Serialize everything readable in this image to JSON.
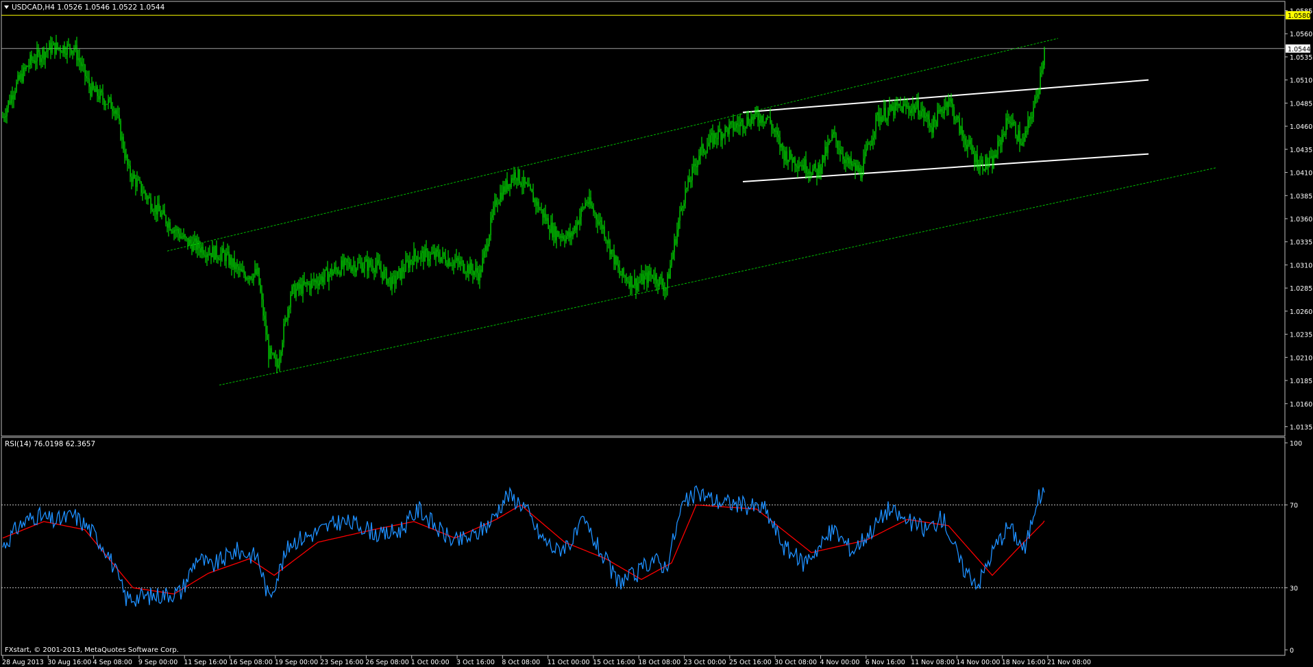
{
  "symbol_header": "USDCAD,H4  1.0526 1.0546 1.0522 1.0544",
  "indicator_header": "RSI(14) 76.0198 62.3657",
  "copyright": "FXstart, © 2001-2013, MetaQuotes Software Corp.",
  "colors": {
    "background": "#000000",
    "candle": "#00ff00",
    "grid_frame": "#c0c0c0",
    "resistance_line": "#ffff00",
    "channel_lines": "#00c000",
    "range_lines": "#ffffff",
    "rsi_line": "#1e90ff",
    "rsi_signal": "#ff0000"
  },
  "price_axis": {
    "ticks": [
      "1.0585",
      "1.0560",
      "1.0535",
      "1.0510",
      "1.0485",
      "1.0460",
      "1.0435",
      "1.0410",
      "1.0385",
      "1.0360",
      "1.0335",
      "1.0310",
      "1.0285",
      "1.0260",
      "1.0235",
      "1.0210",
      "1.0185",
      "1.0160",
      "1.0135"
    ],
    "current_price_label": "1.0544",
    "resistance_label": "1.0580"
  },
  "rsi_axis": {
    "ticks": [
      "100",
      "70",
      "30",
      "0"
    ]
  },
  "time_axis": {
    "labels": [
      "28 Aug 2013",
      "30 Aug 16:00",
      "4 Sep 08:00",
      "9 Sep 00:00",
      "11 Sep 16:00",
      "16 Sep 08:00",
      "19 Sep 00:00",
      "23 Sep 16:00",
      "26 Sep 08:00",
      "1 Oct 00:00",
      "3 Oct 16:00",
      "8 Oct 08:00",
      "11 Oct 00:00",
      "15 Oct 16:00",
      "18 Oct 08:00",
      "23 Oct 00:00",
      "25 Oct 16:00",
      "30 Oct 08:00",
      "4 Nov 00:00",
      "6 Nov 16:00",
      "11 Nov 08:00",
      "14 Nov 00:00",
      "18 Nov 16:00",
      "21 Nov 08:00"
    ]
  },
  "chart_data": [
    {
      "type": "candlestick",
      "title": "USDCAD,H4",
      "ylim": [
        1.0125,
        1.0595
      ],
      "last_ohlc": {
        "open": 1.0526,
        "high": 1.0546,
        "low": 1.0522,
        "close": 1.0544
      },
      "price_path_waypoints": [
        {
          "t": 0,
          "p": 1.047
        },
        {
          "t": 8,
          "p": 1.05
        },
        {
          "t": 20,
          "p": 1.053
        },
        {
          "t": 35,
          "p": 1.0545
        },
        {
          "t": 52,
          "p": 1.0545
        },
        {
          "t": 64,
          "p": 1.05
        },
        {
          "t": 82,
          "p": 1.048
        },
        {
          "t": 92,
          "p": 1.041
        },
        {
          "t": 112,
          "p": 1.037
        },
        {
          "t": 134,
          "p": 1.0335
        },
        {
          "t": 150,
          "p": 1.0325
        },
        {
          "t": 162,
          "p": 1.032
        },
        {
          "t": 174,
          "p": 1.03
        },
        {
          "t": 186,
          "p": 1.03
        },
        {
          "t": 194,
          "p": 1.0215
        },
        {
          "t": 200,
          "p": 1.02
        },
        {
          "t": 210,
          "p": 1.028
        },
        {
          "t": 225,
          "p": 1.029
        },
        {
          "t": 250,
          "p": 1.031
        },
        {
          "t": 272,
          "p": 1.031
        },
        {
          "t": 284,
          "p": 1.029
        },
        {
          "t": 300,
          "p": 1.032
        },
        {
          "t": 318,
          "p": 1.032
        },
        {
          "t": 335,
          "p": 1.031
        },
        {
          "t": 348,
          "p": 1.03
        },
        {
          "t": 360,
          "p": 1.038
        },
        {
          "t": 374,
          "p": 1.041
        },
        {
          "t": 388,
          "p": 1.038
        },
        {
          "t": 402,
          "p": 1.0345
        },
        {
          "t": 414,
          "p": 1.034
        },
        {
          "t": 426,
          "p": 1.038
        },
        {
          "t": 438,
          "p": 1.035
        },
        {
          "t": 450,
          "p": 1.03
        },
        {
          "t": 462,
          "p": 1.029
        },
        {
          "t": 474,
          "p": 1.03
        },
        {
          "t": 484,
          "p": 1.0285
        },
        {
          "t": 496,
          "p": 1.038
        },
        {
          "t": 508,
          "p": 1.043
        },
        {
          "t": 520,
          "p": 1.045
        },
        {
          "t": 534,
          "p": 1.046
        },
        {
          "t": 548,
          "p": 1.047
        },
        {
          "t": 558,
          "p": 1.047
        },
        {
          "t": 570,
          "p": 1.043
        },
        {
          "t": 582,
          "p": 1.042
        },
        {
          "t": 594,
          "p": 1.041
        },
        {
          "t": 606,
          "p": 1.045
        },
        {
          "t": 616,
          "p": 1.042
        },
        {
          "t": 626,
          "p": 1.041
        },
        {
          "t": 638,
          "p": 1.047
        },
        {
          "t": 654,
          "p": 1.048
        },
        {
          "t": 668,
          "p": 1.048
        },
        {
          "t": 678,
          "p": 1.046
        },
        {
          "t": 690,
          "p": 1.049
        },
        {
          "t": 700,
          "p": 1.045
        },
        {
          "t": 712,
          "p": 1.042
        },
        {
          "t": 722,
          "p": 1.042
        },
        {
          "t": 734,
          "p": 1.047
        },
        {
          "t": 744,
          "p": 1.044
        },
        {
          "t": 754,
          "p": 1.049
        },
        {
          "t": 760,
          "p": 1.0544
        }
      ],
      "annotations": [
        {
          "kind": "horizontal",
          "price": 1.058,
          "label": "1.0580"
        },
        {
          "kind": "horizontal",
          "price": 1.0544,
          "label": "1.0544"
        },
        {
          "kind": "trendline",
          "name": "channel-upper",
          "from": {
            "t": 120,
            "p": 1.0325
          },
          "to": {
            "t": 770,
            "p": 1.0555
          }
        },
        {
          "kind": "trendline",
          "name": "channel-lower",
          "from": {
            "t": 158,
            "p": 1.018
          },
          "to": {
            "t": 885,
            "p": 1.0415
          }
        },
        {
          "kind": "trendline",
          "name": "range-upper",
          "from": {
            "t": 540,
            "p": 1.0475
          },
          "to": {
            "t": 836,
            "p": 1.051
          }
        },
        {
          "kind": "trendline",
          "name": "range-lower",
          "from": {
            "t": 540,
            "p": 1.04
          },
          "to": {
            "t": 836,
            "p": 1.043
          }
        }
      ]
    },
    {
      "type": "line",
      "title": "RSI(14)",
      "ylim": [
        0,
        100
      ],
      "levels": [
        70,
        30
      ],
      "last_values": {
        "rsi": 76.0198,
        "signal": 62.3657
      },
      "rsi_waypoints": [
        {
          "t": 0,
          "v": 50
        },
        {
          "t": 12,
          "v": 60
        },
        {
          "t": 24,
          "v": 65
        },
        {
          "t": 38,
          "v": 62
        },
        {
          "t": 52,
          "v": 65
        },
        {
          "t": 64,
          "v": 58
        },
        {
          "t": 76,
          "v": 48
        },
        {
          "t": 90,
          "v": 25
        },
        {
          "t": 110,
          "v": 26
        },
        {
          "t": 130,
          "v": 28
        },
        {
          "t": 142,
          "v": 45
        },
        {
          "t": 152,
          "v": 40
        },
        {
          "t": 170,
          "v": 48
        },
        {
          "t": 186,
          "v": 45
        },
        {
          "t": 194,
          "v": 25
        },
        {
          "t": 210,
          "v": 52
        },
        {
          "t": 226,
          "v": 56
        },
        {
          "t": 246,
          "v": 62
        },
        {
          "t": 262,
          "v": 60
        },
        {
          "t": 276,
          "v": 55
        },
        {
          "t": 290,
          "v": 58
        },
        {
          "t": 304,
          "v": 68
        },
        {
          "t": 318,
          "v": 58
        },
        {
          "t": 330,
          "v": 52
        },
        {
          "t": 344,
          "v": 55
        },
        {
          "t": 356,
          "v": 62
        },
        {
          "t": 368,
          "v": 75
        },
        {
          "t": 380,
          "v": 70
        },
        {
          "t": 392,
          "v": 55
        },
        {
          "t": 404,
          "v": 48
        },
        {
          "t": 416,
          "v": 53
        },
        {
          "t": 424,
          "v": 62
        },
        {
          "t": 434,
          "v": 50
        },
        {
          "t": 448,
          "v": 33
        },
        {
          "t": 462,
          "v": 36
        },
        {
          "t": 474,
          "v": 44
        },
        {
          "t": 484,
          "v": 40
        },
        {
          "t": 496,
          "v": 70
        },
        {
          "t": 508,
          "v": 76
        },
        {
          "t": 520,
          "v": 72
        },
        {
          "t": 540,
          "v": 70
        },
        {
          "t": 556,
          "v": 68
        },
        {
          "t": 570,
          "v": 50
        },
        {
          "t": 584,
          "v": 42
        },
        {
          "t": 596,
          "v": 50
        },
        {
          "t": 606,
          "v": 58
        },
        {
          "t": 620,
          "v": 48
        },
        {
          "t": 634,
          "v": 58
        },
        {
          "t": 646,
          "v": 68
        },
        {
          "t": 660,
          "v": 62
        },
        {
          "t": 674,
          "v": 58
        },
        {
          "t": 686,
          "v": 64
        },
        {
          "t": 700,
          "v": 40
        },
        {
          "t": 712,
          "v": 32
        },
        {
          "t": 724,
          "v": 50
        },
        {
          "t": 734,
          "v": 60
        },
        {
          "t": 746,
          "v": 48
        },
        {
          "t": 754,
          "v": 72
        },
        {
          "t": 760,
          "v": 76
        }
      ],
      "signal_waypoints": [
        {
          "t": 0,
          "v": 54
        },
        {
          "t": 30,
          "v": 62
        },
        {
          "t": 60,
          "v": 58
        },
        {
          "t": 95,
          "v": 30
        },
        {
          "t": 125,
          "v": 27
        },
        {
          "t": 150,
          "v": 37
        },
        {
          "t": 180,
          "v": 44
        },
        {
          "t": 198,
          "v": 36
        },
        {
          "t": 230,
          "v": 52
        },
        {
          "t": 270,
          "v": 58
        },
        {
          "t": 300,
          "v": 62
        },
        {
          "t": 330,
          "v": 54
        },
        {
          "t": 360,
          "v": 63
        },
        {
          "t": 378,
          "v": 70
        },
        {
          "t": 410,
          "v": 52
        },
        {
          "t": 440,
          "v": 44
        },
        {
          "t": 466,
          "v": 34
        },
        {
          "t": 488,
          "v": 42
        },
        {
          "t": 506,
          "v": 70
        },
        {
          "t": 550,
          "v": 68
        },
        {
          "t": 590,
          "v": 47
        },
        {
          "t": 630,
          "v": 53
        },
        {
          "t": 660,
          "v": 63
        },
        {
          "t": 690,
          "v": 60
        },
        {
          "t": 722,
          "v": 36
        },
        {
          "t": 745,
          "v": 52
        },
        {
          "t": 760,
          "v": 62
        }
      ]
    }
  ]
}
